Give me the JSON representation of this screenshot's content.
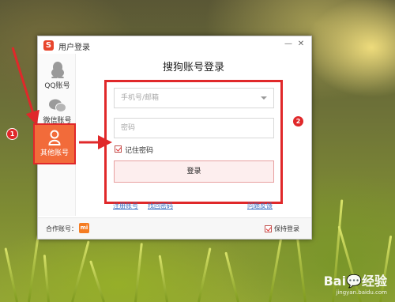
{
  "window": {
    "title": "用户登录",
    "logo_text": "S",
    "minimize_icon": "—",
    "close_icon": "✕"
  },
  "sidebar": {
    "items": [
      {
        "label": "QQ账号",
        "icon": "penguin-icon"
      },
      {
        "label": "微信账号",
        "icon": "wechat-icon"
      },
      {
        "label": "其他账号",
        "icon": "user-icon",
        "active": true
      }
    ]
  },
  "main": {
    "heading": "搜狗账号登录",
    "account_placeholder": "手机号/邮箱",
    "password_placeholder": "密码",
    "remember_label": "记住密码",
    "remember_checked": true,
    "login_button": "登录"
  },
  "links": {
    "register": "注册账号",
    "forgot": "找回密码",
    "feedback": "问题反馈"
  },
  "footer": {
    "partner_label": "合作账号：",
    "partner_logo_text": "mi",
    "keep_login_label": "保持登录",
    "keep_login_checked": true
  },
  "annotations": {
    "badge1": "1",
    "badge2": "2"
  },
  "watermark": {
    "brand": "Bai💬经验",
    "url": "jingyan.baidu.com"
  },
  "colors": {
    "accent_red": "#e0282a",
    "active_orange": "#f26b3a",
    "link_blue": "#3a6fc4"
  }
}
